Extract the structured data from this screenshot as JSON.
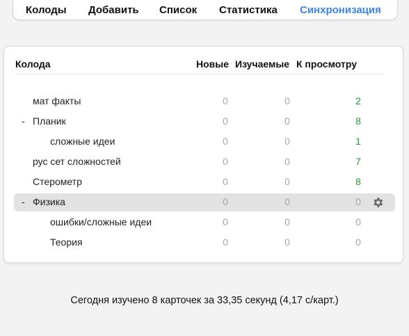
{
  "nav": {
    "items": [
      {
        "label": "Колоды"
      },
      {
        "label": "Добавить"
      },
      {
        "label": "Список"
      },
      {
        "label": "Статистика"
      },
      {
        "label": "Синхронизация"
      }
    ],
    "active_color": "#3d84e6"
  },
  "table": {
    "headers": {
      "deck": "Колода",
      "new": "Новые",
      "learning": "Изучаемые",
      "review": "К просмотру"
    },
    "rows": [
      {
        "collapse": "",
        "name": "мат факты",
        "new": "0",
        "learning": "0",
        "review": "2"
      },
      {
        "collapse": "-",
        "name": "Планик",
        "new": "0",
        "learning": "0",
        "review": "8"
      },
      {
        "collapse": "",
        "name": "сложные идеи",
        "new": "0",
        "learning": "0",
        "review": "1"
      },
      {
        "collapse": "",
        "name": "рус сет сложностей",
        "new": "0",
        "learning": "0",
        "review": "7"
      },
      {
        "collapse": "",
        "name": "Стерометр",
        "new": "0",
        "learning": "0",
        "review": "8"
      },
      {
        "collapse": "-",
        "name": "Физика",
        "new": "0",
        "learning": "0",
        "review": "0",
        "selected": true,
        "icon": "gear-icon"
      },
      {
        "collapse": "",
        "name": "ошибки/сложные идеи",
        "new": "0",
        "learning": "0",
        "review": "0"
      },
      {
        "collapse": "",
        "name": "Теория",
        "new": "0",
        "learning": "0",
        "review": "0"
      }
    ],
    "due_color": "#1f9a3a",
    "zero_color": "#a7a7a7"
  },
  "footer": {
    "text": "Сегодня изучено 8 карточек за 33,35 секунд (4,17 с/карт.)"
  }
}
